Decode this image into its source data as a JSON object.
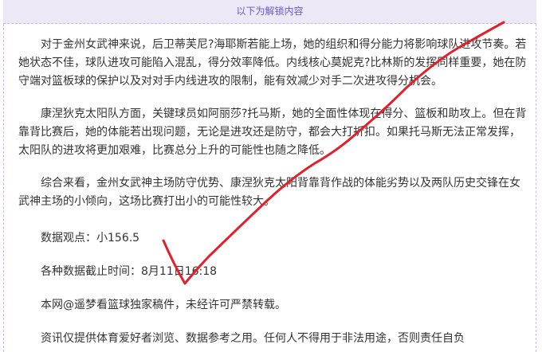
{
  "header": {
    "unlock_label": "以下为解锁内容"
  },
  "article": {
    "paragraph_1": "对于金州女武神来说，后卫蒂芙尼?海耶斯若能上场，她的组织和得分能力将影响球队进攻节奏。若她状态不佳，球队进攻可能陷入混乱，得分效率降低。内线核心莫妮克?比林斯的发挥同样重要，她在防守端对篮板球的保护以及对对手内线进攻的限制，能有效减少对手二次进攻得分机会。",
    "paragraph_2": "康涅狄克太阳队方面，关键球员如阿丽莎?托马斯，她的全面性体现在得分、篮板和助攻上。但在背靠背比赛后，她的体能若出现问题，无论是进攻还是防守，都会大打折扣。如果托马斯无法正常发挥，太阳队的进攻将更加艰难，比赛总分上升的可能性也随之降低。",
    "paragraph_3": "综合来看，金州女武神主场防守优势、康涅狄克太阳背靠背作战的体能劣势以及两队历史交锋在女武神主场的小倾向，这场比赛打出小的可能性较大。",
    "data_view": "数据观点：小156.5",
    "data_cutoff": "各种数据截止时间：8月11日16:18",
    "copyright": "本网@遥梦看篮球独家稿件，未经许可严禁转载。",
    "disclaimer": "资讯仅提供体育爱好者浏览、数据参考之用。任何人不得用于非法用途，否则责任自负"
  },
  "annotation": {
    "stroke_color": "#e0202a"
  }
}
